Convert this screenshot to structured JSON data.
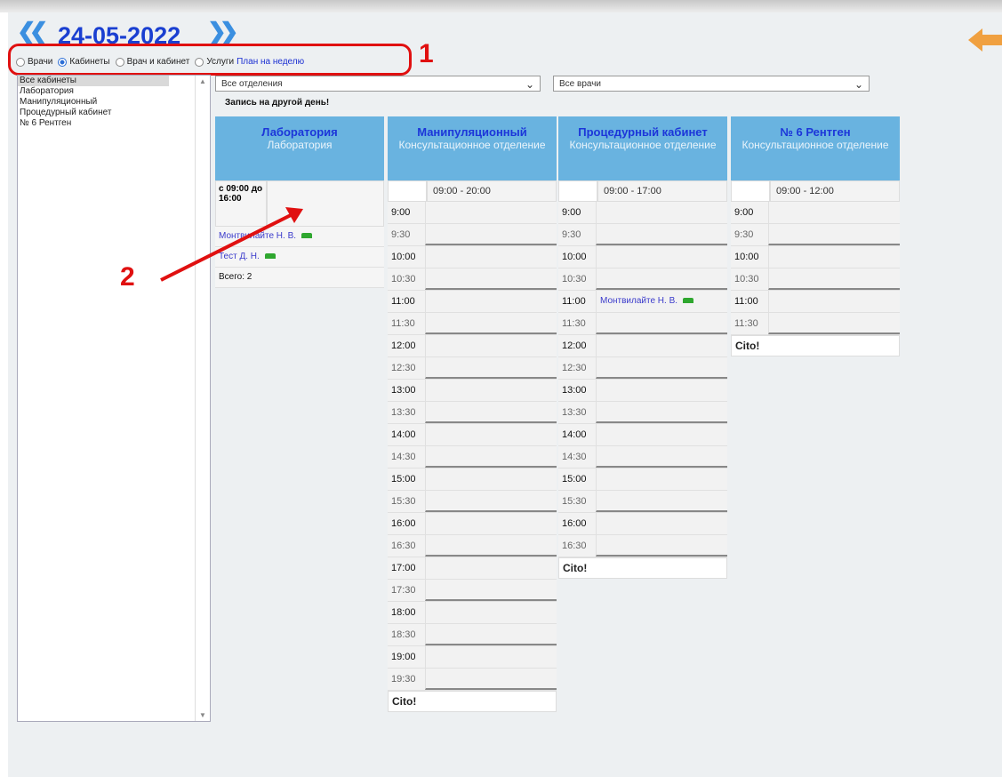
{
  "header": {
    "date": "24-05-2022",
    "prev_label": "«",
    "next_label": "»"
  },
  "modes": {
    "items": [
      {
        "label": "Врачи",
        "selected": false
      },
      {
        "label": "Кабинеты",
        "selected": true
      },
      {
        "label": "Врач и кабинет",
        "selected": false
      },
      {
        "label": "Услуги",
        "selected": false
      }
    ],
    "plan_link": "План на неделю"
  },
  "annotations": {
    "mark1": "1",
    "mark2": "2"
  },
  "sidebar": {
    "items": [
      "Все кабинеты",
      "Лаборатория",
      "Манипуляционный",
      "Процедурный кабинет",
      "№ 6 Рентген"
    ]
  },
  "filters": {
    "departments": "Все отделения",
    "doctors": "Все врачи"
  },
  "note": "Запись на другой день!",
  "columns": {
    "lab": {
      "title": "Лаборатория",
      "subtitle": "Лаборатория",
      "hours": "с 09:00 до 16:00",
      "patients": [
        "Монтвилайте Н. В.",
        "Тест Д. Н."
      ],
      "total": "Всего: 2"
    },
    "manip": {
      "title": "Манипуляционный",
      "subtitle": "Консультационное отделение",
      "hours": "09:00 - 20:00",
      "cito": "Cito!"
    },
    "proc": {
      "title": "Процедурный кабинет",
      "subtitle": "Консультационное отделение",
      "hours": "09:00 - 17:00",
      "cito": "Cito!",
      "booking_time": "11:00",
      "booking": "Монтвилайте Н. В."
    },
    "xray": {
      "title": "№ 6 Рентген",
      "subtitle": "Консультационное отделение",
      "hours": "09:00 - 12:00",
      "cito": "Cito!"
    }
  },
  "slots": [
    "9:00",
    "9:30",
    "10:00",
    "10:30",
    "11:00",
    "11:30",
    "12:00",
    "12:30",
    "13:00",
    "13:30",
    "14:00",
    "14:30",
    "15:00",
    "15:30",
    "16:00",
    "16:30",
    "17:00",
    "17:30",
    "18:00",
    "18:30",
    "19:00",
    "19:30"
  ],
  "colors": {
    "header_bg": "#69b3e0",
    "title": "#1c36d9",
    "annotation": "#e01010"
  }
}
